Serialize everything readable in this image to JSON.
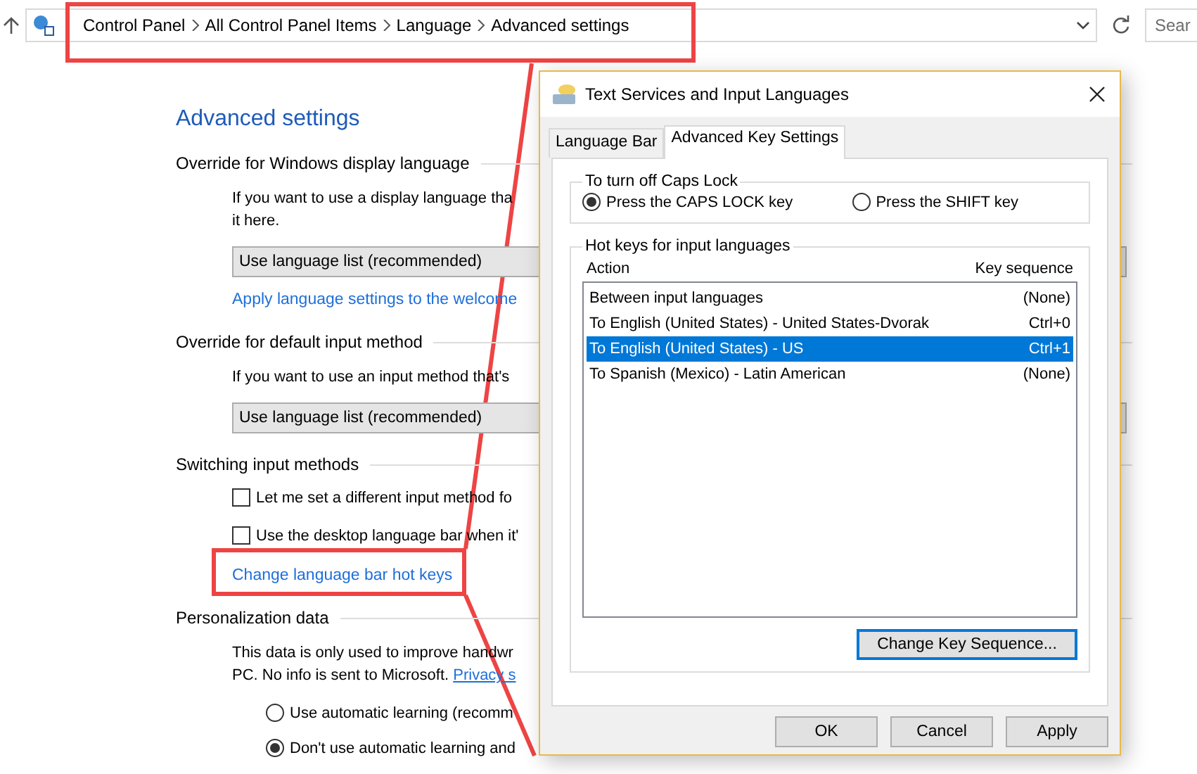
{
  "address_bar": {
    "breadcrumb": [
      "Control Panel",
      "All Control Panel Items",
      "Language",
      "Advanced settings"
    ],
    "search": {
      "placeholder": "Sear"
    }
  },
  "page": {
    "title": "Advanced settings",
    "sections": [
      {
        "heading": "Override for Windows display language",
        "items": [
          {
            "kind": "text",
            "text": "If you want to use a display language tha"
          },
          {
            "kind": "text",
            "text": "it here."
          },
          {
            "kind": "select",
            "value": "Use language list (recommended)"
          },
          {
            "kind": "link",
            "text": "Apply language settings to the welcome"
          }
        ]
      },
      {
        "heading": "Override for default input method",
        "items": [
          {
            "kind": "text",
            "text": "If you want to use an input method that's"
          },
          {
            "kind": "select",
            "value": "Use language list (recommended)"
          }
        ]
      },
      {
        "heading": "Switching input methods",
        "items": [
          {
            "kind": "checkbox",
            "label": "Let me set a different input method fo",
            "checked": false
          },
          {
            "kind": "checkbox",
            "label": "Use the desktop language bar when it'",
            "checked": false
          },
          {
            "kind": "link",
            "text": "Change language bar hot keys"
          }
        ]
      },
      {
        "heading": "Personalization data",
        "items": [
          {
            "kind": "text",
            "text": "This data is only used to improve handwr"
          },
          {
            "kind": "text_link",
            "text": "PC. No info is sent to Microsoft.",
            "link": "Privacy s"
          },
          {
            "kind": "radio",
            "label": "Use automatic learning (recomm",
            "selected": false
          },
          {
            "kind": "radio",
            "label": "Don't use automatic learning and",
            "selected": true
          }
        ]
      }
    ]
  },
  "dialog": {
    "title": "Text Services and Input Languages",
    "tabs": [
      {
        "label": "Language Bar",
        "selected": false
      },
      {
        "label": "Advanced Key Settings",
        "selected": true
      }
    ],
    "caps_lock": {
      "legend": "To turn off Caps Lock",
      "options": [
        {
          "label": "Press the CAPS LOCK key",
          "selected": true
        },
        {
          "label": "Press the SHIFT key",
          "selected": false
        }
      ]
    },
    "hot_keys": {
      "legend": "Hot keys for input languages",
      "columns": [
        "Action",
        "Key sequence"
      ],
      "rows": [
        {
          "action": "Between input languages",
          "key_sequence": "(None)",
          "selected": false
        },
        {
          "action": "To English (United States) - United States-Dvorak",
          "key_sequence": "Ctrl+0",
          "selected": false
        },
        {
          "action": "To English (United States) - US",
          "key_sequence": "Ctrl+1",
          "selected": true
        },
        {
          "action": "To Spanish (Mexico) - Latin American",
          "key_sequence": "(None)",
          "selected": false
        }
      ],
      "button": "Change Key Sequence..."
    },
    "buttons": [
      "OK",
      "Cancel",
      "Apply"
    ]
  }
}
